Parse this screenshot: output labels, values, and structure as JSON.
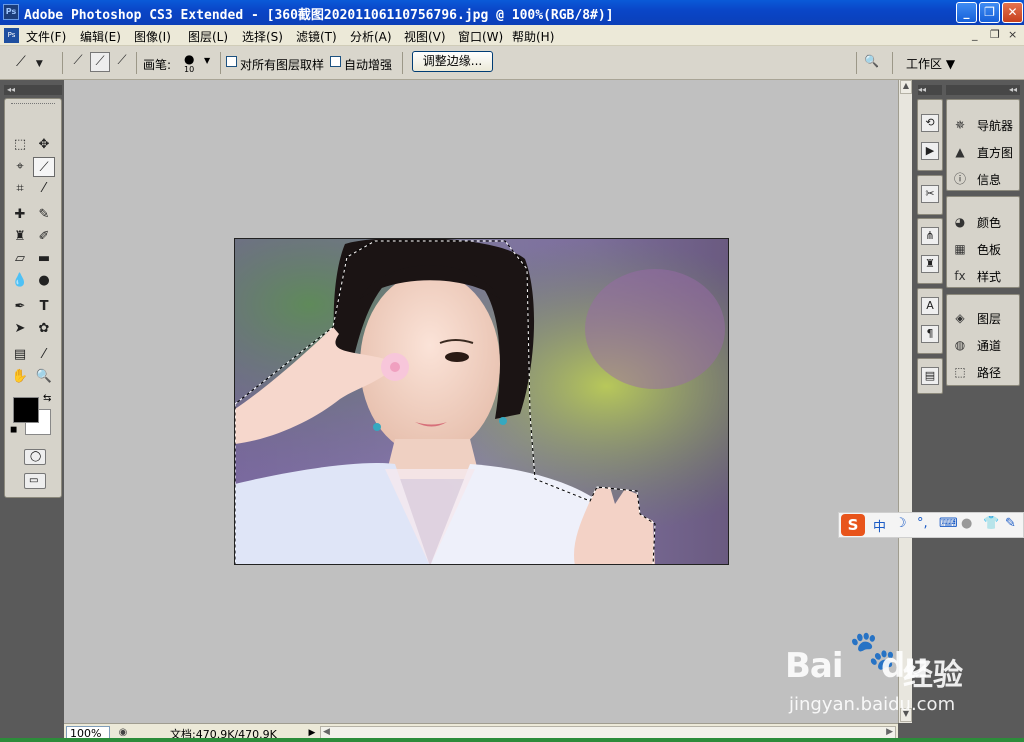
{
  "window": {
    "title": "Adobe Photoshop CS3 Extended - [360截图20201106110756796.jpg @ 100%(RGB/8#)]",
    "app_icon": "Ps",
    "minimize_icon": "minimize-icon",
    "restore_icon": "restore-icon",
    "close_icon": "close-icon"
  },
  "menubar": {
    "ps_icon": "Ps",
    "items": [
      {
        "label": "文件(F)"
      },
      {
        "label": "编辑(E)"
      },
      {
        "label": "图像(I)"
      },
      {
        "label": "图层(L)"
      },
      {
        "label": "选择(S)"
      },
      {
        "label": "滤镜(T)"
      },
      {
        "label": "分析(A)"
      },
      {
        "label": "视图(V)"
      },
      {
        "label": "窗口(W)"
      },
      {
        "label": "帮助(H)"
      }
    ],
    "doc_minimize": "_",
    "doc_restore": "❐",
    "doc_close": "×"
  },
  "options": {
    "brush_label": "画笔:",
    "brush_size": "10",
    "sample_all_label": "对所有图层取样",
    "auto_enhance_label": "自动增强",
    "refine_edge_label": "调整边缘...",
    "workspace_label": "工作区 ▼",
    "sample_all_checked": false,
    "auto_enhance_checked": false
  },
  "toolbox": {
    "foreground_color": "#000000",
    "background_color": "#ffffff",
    "active_tool": "quick-selection-tool"
  },
  "panels": {
    "group1": [
      {
        "label": "导航器",
        "icon": "navigator-icon"
      },
      {
        "label": "直方图",
        "icon": "histogram-icon"
      },
      {
        "label": "信息",
        "icon": "info-icon"
      }
    ],
    "group2": [
      {
        "label": "颜色",
        "icon": "color-icon"
      },
      {
        "label": "色板",
        "icon": "swatches-icon"
      },
      {
        "label": "样式",
        "icon": "styles-icon"
      }
    ],
    "group3": [
      {
        "label": "图层",
        "icon": "layers-icon"
      },
      {
        "label": "通道",
        "icon": "channels-icon"
      },
      {
        "label": "路径",
        "icon": "paths-icon"
      }
    ]
  },
  "ime": {
    "logo": "S",
    "mode": "中"
  },
  "status": {
    "zoom": "100%",
    "doc_size": "文档:470.9K/470.9K"
  },
  "watermark": {
    "logo": "Bai",
    "logo_du": "du",
    "cn": "经验",
    "url": "jingyan.baidu.com"
  }
}
